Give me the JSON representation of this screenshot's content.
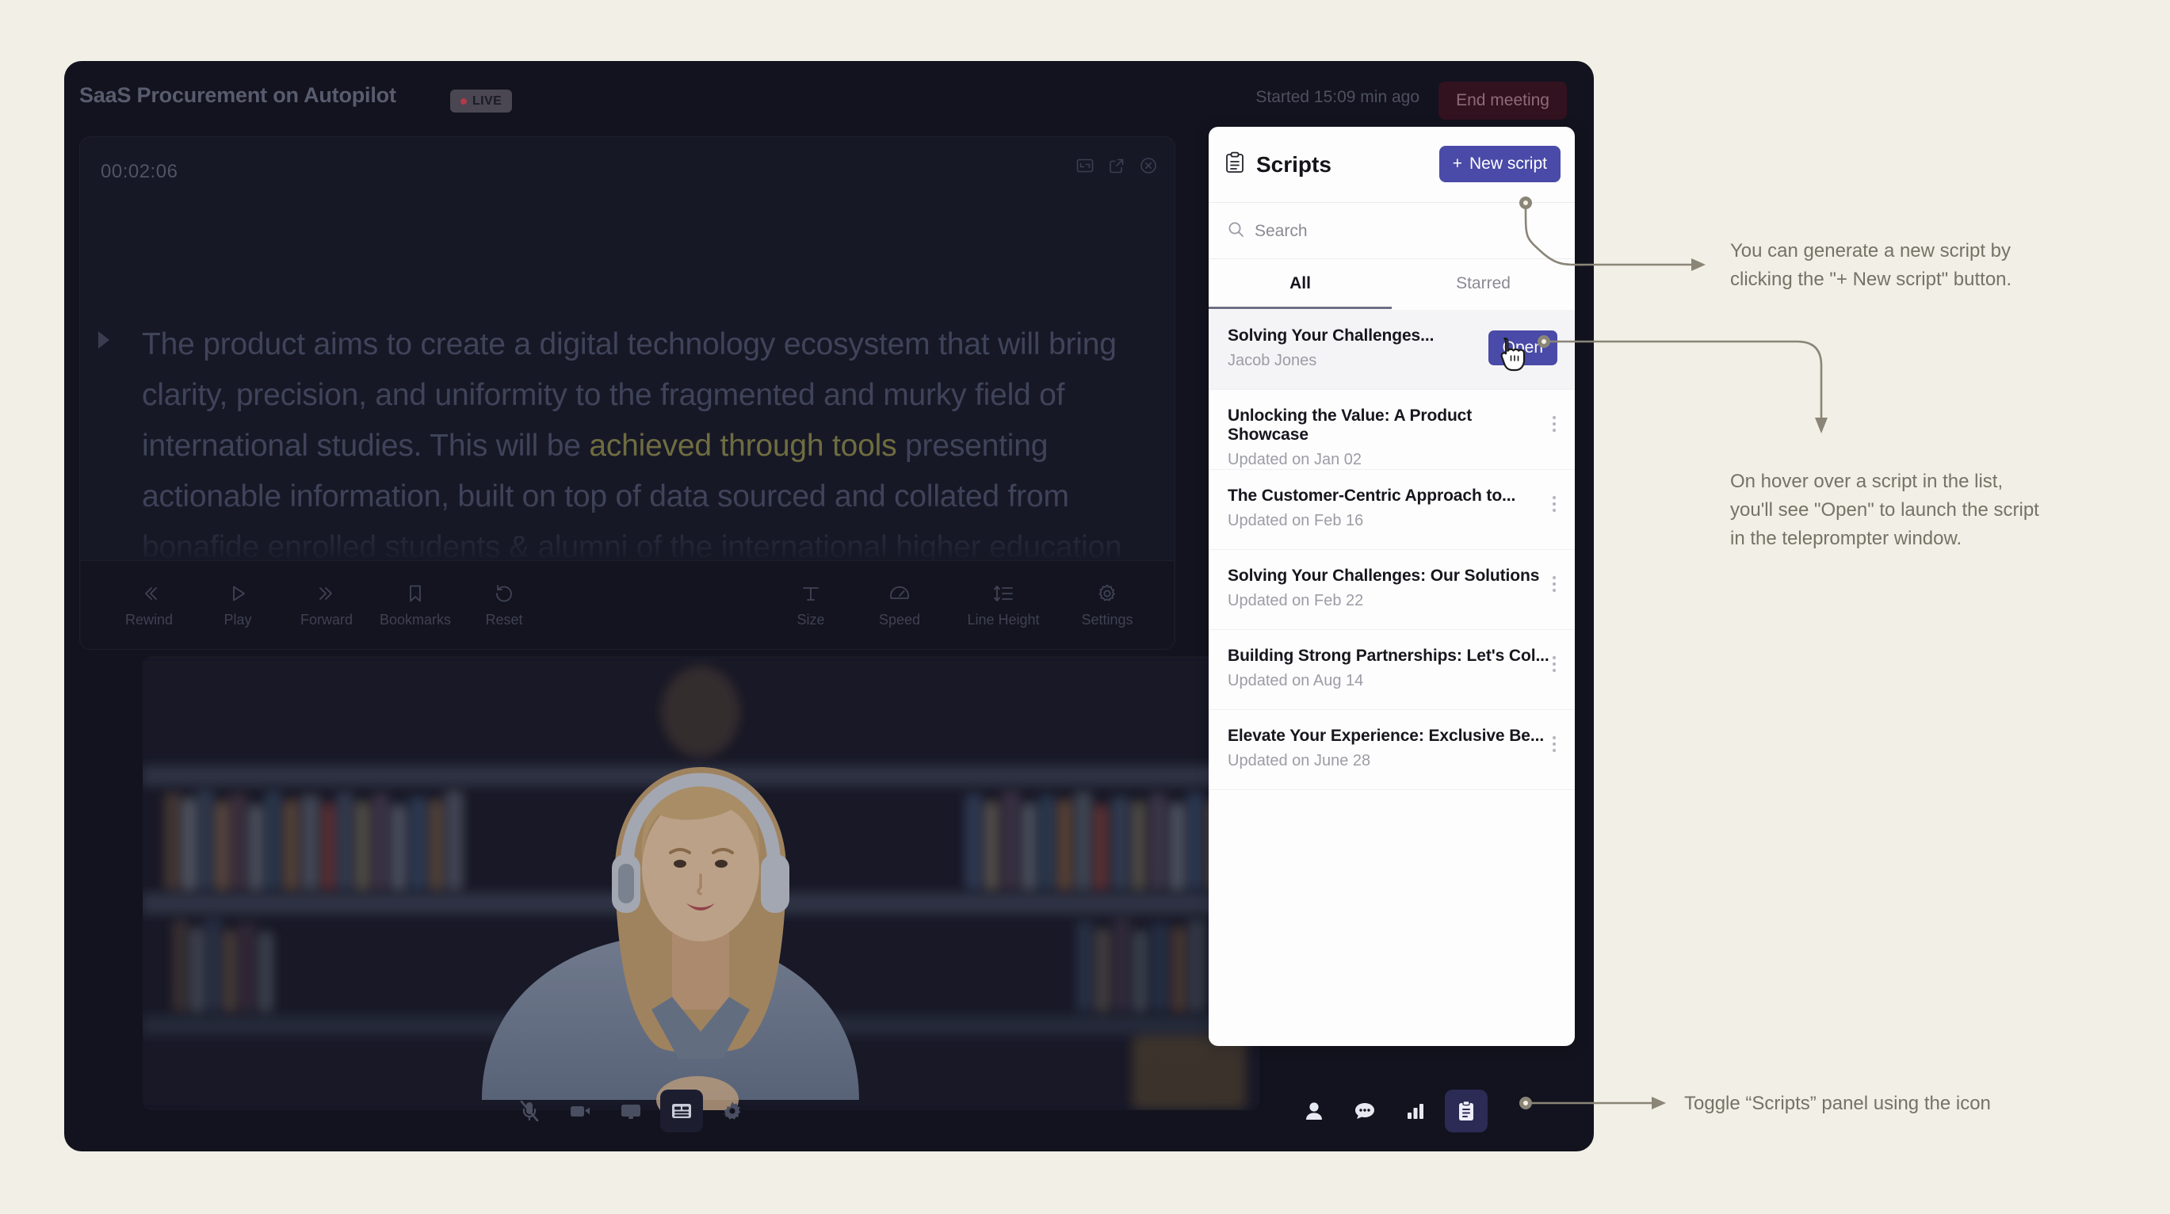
{
  "app": {
    "header": {
      "meeting_title": "SaaS Procurement on Autopilot",
      "live_badge": "LIVE",
      "started_text": "Started 15:09 min ago",
      "end_meeting_label": "End meeting"
    },
    "teleprompter": {
      "timer": "00:02:06",
      "script_text_before": "The product aims to create a digital technology ecosystem that will bring clarity, precision, and uniformity to the fragmented and murky field of international studies. This will be ",
      "script_text_highlight": "achieved through tools",
      "script_text_after": " presenting actionable information, built on top of data sourced and collated from bonafide enrolled students & alumni of the international higher education institutions. The vision for the product is to become",
      "window_controls": [
        "minimize-icon",
        "popout-icon",
        "close-icon"
      ],
      "controls_left": [
        {
          "label": "Rewind",
          "icon": "rewind-icon"
        },
        {
          "label": "Play",
          "icon": "play-icon"
        },
        {
          "label": "Forward",
          "icon": "forward-icon"
        },
        {
          "label": "Bookmarks",
          "icon": "bookmark-icon"
        },
        {
          "label": "Reset",
          "icon": "reset-icon"
        }
      ],
      "controls_right": [
        {
          "label": "Size",
          "icon": "text-size-icon"
        },
        {
          "label": "Speed",
          "icon": "speedometer-icon"
        },
        {
          "label": "Line Height",
          "icon": "line-height-icon"
        },
        {
          "label": "Settings",
          "icon": "gear-icon"
        }
      ]
    },
    "bottom_bar": {
      "left": [
        {
          "name": "microphone-muted-icon",
          "active": false
        },
        {
          "name": "camera-icon",
          "active": false
        },
        {
          "name": "screen-share-icon",
          "active": false
        },
        {
          "name": "teleprompter-icon",
          "active": true
        },
        {
          "name": "settings-gear-icon",
          "active": false
        }
      ],
      "right": [
        {
          "name": "participants-icon",
          "active": false
        },
        {
          "name": "chat-icon",
          "active": false
        },
        {
          "name": "analytics-icon",
          "active": false
        },
        {
          "name": "scripts-icon",
          "active": true
        }
      ]
    }
  },
  "scripts_panel": {
    "title": "Scripts",
    "title_icon": "clipboard-icon",
    "new_script_label": "New script",
    "new_script_plus": "+",
    "search_placeholder": "Search",
    "search_value": "",
    "tabs": [
      {
        "label": "All",
        "selected": true
      },
      {
        "label": "Starred",
        "selected": false
      }
    ],
    "items": [
      {
        "title": "Solving Your Challenges...",
        "subtitle": "Jacob Jones",
        "hovered": true,
        "action_label": "Open"
      },
      {
        "title": "Unlocking the Value: A Product Showcase",
        "subtitle": "Updated on Jan 02",
        "hovered": false
      },
      {
        "title": "The Customer-Centric Approach to...",
        "subtitle": "Updated on Feb 16",
        "hovered": false
      },
      {
        "title": "Solving Your Challenges: Our Solutions",
        "subtitle": "Updated on Feb 22",
        "hovered": false
      },
      {
        "title": "Building Strong Partnerships: Let's Col...",
        "subtitle": "Updated on Aug 14",
        "hovered": false
      },
      {
        "title": "Elevate Your Experience: Exclusive Be...",
        "subtitle": "Updated on June 28",
        "hovered": false
      }
    ]
  },
  "annotations": [
    {
      "text_line1": "You can generate a new script by",
      "text_line2": "clicking the \"+ New script\" button."
    },
    {
      "text_line1": "On hover over a script in the list,",
      "text_line2": "you'll see \"Open\" to launch the script",
      "text_line3": "in the teleprompter window."
    },
    {
      "text_line1": "Toggle “Scripts” panel using the icon"
    }
  ],
  "colors": {
    "page_bg": "#F1EFE6",
    "app_bg": "#12131E",
    "accent_purple": "#4A4AA8",
    "annotation_text": "#767266",
    "live_red": "#B13A4A",
    "highlight_text": "#6F6D40"
  }
}
